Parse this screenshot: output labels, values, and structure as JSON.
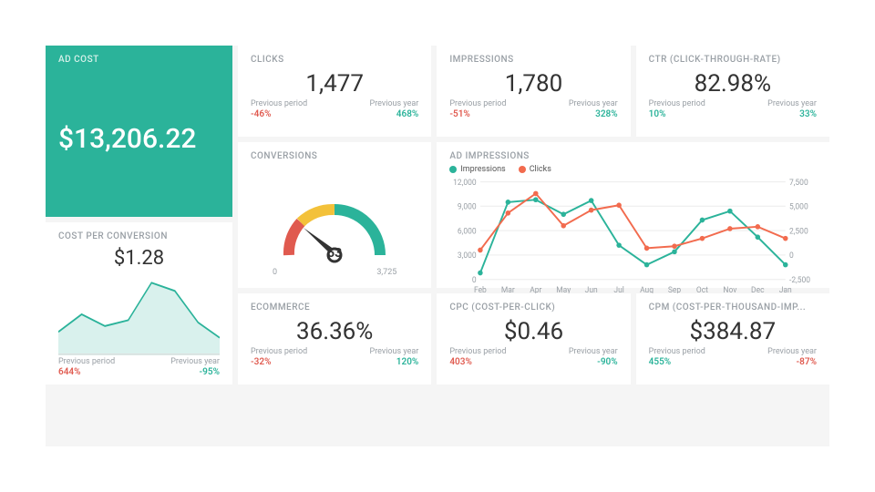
{
  "labels": {
    "prev_period": "Previous period",
    "prev_year": "Previous year"
  },
  "hero": {
    "title": "AD COST",
    "value": "$13,206.22"
  },
  "cost_per_conv": {
    "title": "COST PER CONVERSION",
    "value": "$1.28",
    "prev_period_delta": "644%",
    "prev_period_dir": "down",
    "prev_year_delta": "-95%",
    "prev_year_dir": "up"
  },
  "clicks": {
    "title": "CLICKS",
    "value": "1,477",
    "prev_period_delta": "-46%",
    "prev_period_dir": "down",
    "prev_year_delta": "468%",
    "prev_year_dir": "up"
  },
  "impressions": {
    "title": "IMPRESSIONS",
    "value": "1,780",
    "prev_period_delta": "-51%",
    "prev_period_dir": "down",
    "prev_year_delta": "328%",
    "prev_year_dir": "up"
  },
  "ctr": {
    "title": "CTR (CLICK-THROUGH-RATE)",
    "value": "82.98%",
    "prev_period_delta": "10%",
    "prev_period_dir": "up",
    "prev_year_delta": "33%",
    "prev_year_dir": "up"
  },
  "conversions": {
    "title": "CONVERSIONS",
    "value": "53",
    "min": "0",
    "max": "3,725"
  },
  "ad_impressions_chart": {
    "title": "AD IMPRESSIONS",
    "legend_impressions": "Impressions",
    "legend_clicks": "Clicks"
  },
  "ecommerce": {
    "title": "ECOMMERCE",
    "value": "36.36%",
    "prev_period_delta": "-32%",
    "prev_period_dir": "down",
    "prev_year_delta": "120%",
    "prev_year_dir": "up"
  },
  "cpc": {
    "title": "CPC (COST-PER-CLICK)",
    "value": "$0.46",
    "prev_period_delta": "403%",
    "prev_period_dir": "down",
    "prev_year_delta": "-90%",
    "prev_year_dir": "up"
  },
  "cpm": {
    "title": "CPM (COST-PER-THOUSAND-IMP...",
    "value": "$384.87",
    "prev_period_delta": "455%",
    "prev_period_dir": "up",
    "prev_year_delta": "-87%",
    "prev_year_dir": "down"
  },
  "colors": {
    "green": "#2bb39a",
    "orange": "#f26b4e",
    "yellow": "#f3c13a",
    "red": "#e05a4f"
  },
  "chart_data": [
    {
      "type": "area",
      "title": "COST PER CONVERSION",
      "x": [
        0,
        1,
        2,
        3,
        4,
        5,
        6,
        7
      ],
      "values": [
        1.0,
        1.6,
        1.2,
        1.4,
        3.0,
        2.6,
        1.4,
        0.6
      ],
      "ylim": [
        0,
        3.2
      ]
    },
    {
      "type": "gauge",
      "title": "CONVERSIONS",
      "value": 53,
      "min": 0,
      "max": 3725,
      "segments": [
        {
          "color": "#e05a4f",
          "from": 0,
          "to": 1000
        },
        {
          "color": "#f3c13a",
          "from": 1000,
          "to": 1900
        },
        {
          "color": "#2bb39a",
          "from": 1900,
          "to": 3725
        }
      ]
    },
    {
      "type": "line",
      "title": "AD IMPRESSIONS",
      "categories": [
        "Feb",
        "Mar",
        "Apr",
        "May",
        "Jun",
        "Jul",
        "Aug",
        "Sep",
        "Oct",
        "Nov",
        "Dec",
        "Jan"
      ],
      "series": [
        {
          "name": "Impressions",
          "color": "#2bb39a",
          "values": [
            800,
            9500,
            9800,
            8000,
            9700,
            4200,
            1800,
            3400,
            7300,
            8400,
            5200,
            1800
          ]
        },
        {
          "name": "Clicks",
          "color": "#f26b4e",
          "values": [
            500,
            4300,
            6300,
            3000,
            4600,
            5100,
            700,
            900,
            1700,
            2700,
            2900,
            1700
          ]
        }
      ],
      "y_left": {
        "label": "",
        "ticks": [
          0,
          3000,
          6000,
          9000,
          12000
        ]
      },
      "y_right": {
        "label": "",
        "ticks": [
          -2500,
          0,
          2500,
          5000,
          7500
        ]
      }
    }
  ]
}
